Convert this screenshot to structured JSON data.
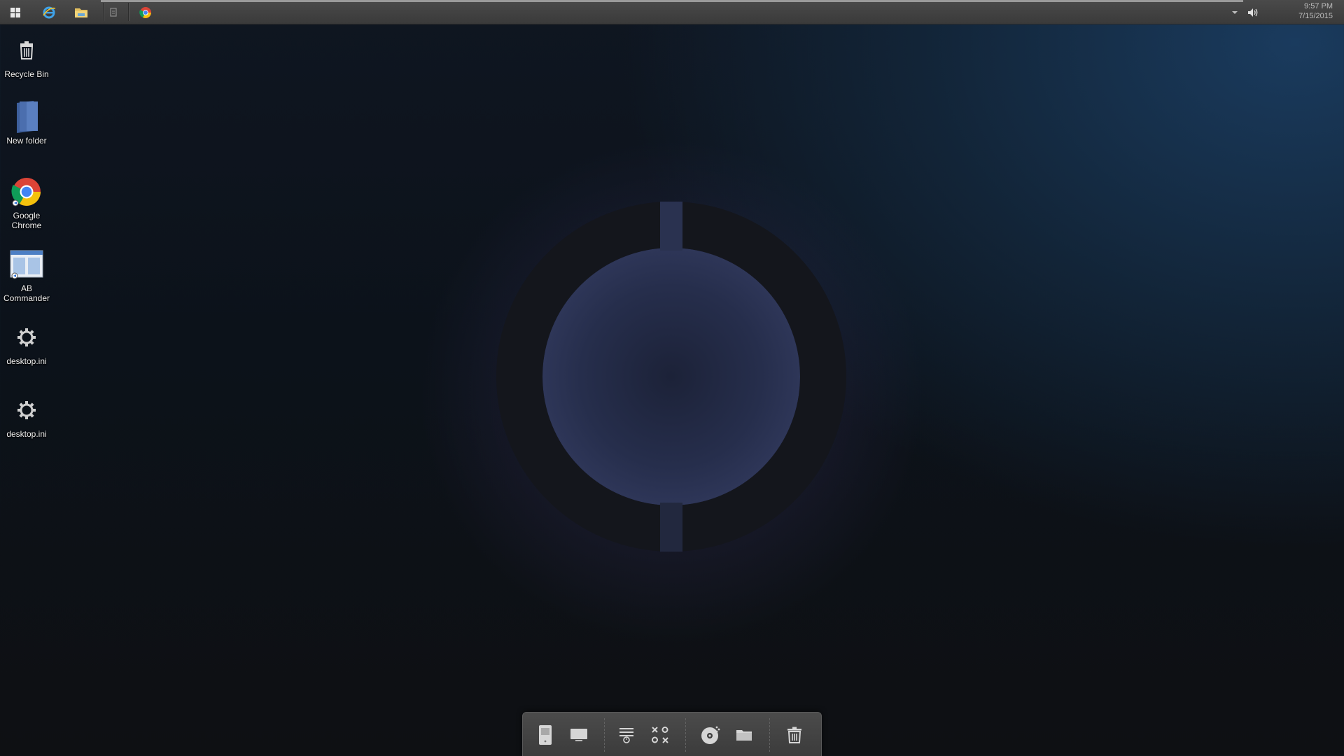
{
  "taskbar": {
    "pinned": [
      {
        "icon": "windows-start-icon"
      },
      {
        "icon": "internet-explorer-icon"
      },
      {
        "icon": "file-explorer-icon"
      },
      {
        "icon": "notepad-icon"
      },
      {
        "icon": "chrome-icon"
      }
    ],
    "tray": {
      "chevron_icon": "chevron-down-icon",
      "volume_icon": "volume-icon"
    },
    "clock": {
      "time": "9:57 PM",
      "date": "7/15/2015"
    }
  },
  "desktop": {
    "icons": [
      {
        "label": "Recycle Bin",
        "icon": "recycle-bin-icon"
      },
      {
        "label": "New folder",
        "icon": "folder-icon"
      },
      {
        "label": "Google Chrome",
        "icon": "chrome-icon"
      },
      {
        "label": "AB Commander",
        "icon": "ab-commander-icon"
      },
      {
        "label": "desktop.ini",
        "icon": "settings-file-icon"
      },
      {
        "label": "desktop.ini",
        "icon": "settings-file-icon"
      }
    ]
  },
  "dock": {
    "items": [
      {
        "icon": "computer-icon"
      },
      {
        "icon": "monitor-icon"
      },
      {
        "icon": "task-list-icon"
      },
      {
        "icon": "tic-tac-toe-icon"
      },
      {
        "icon": "disc-icon"
      },
      {
        "icon": "folder-icon"
      },
      {
        "icon": "trash-icon"
      }
    ]
  },
  "colors": {
    "desktop_bg": "#0e141d",
    "desktop_glow": "#1a3b5e",
    "logo": "#14161c",
    "taskbar": "#404040",
    "dock": "#434343"
  }
}
